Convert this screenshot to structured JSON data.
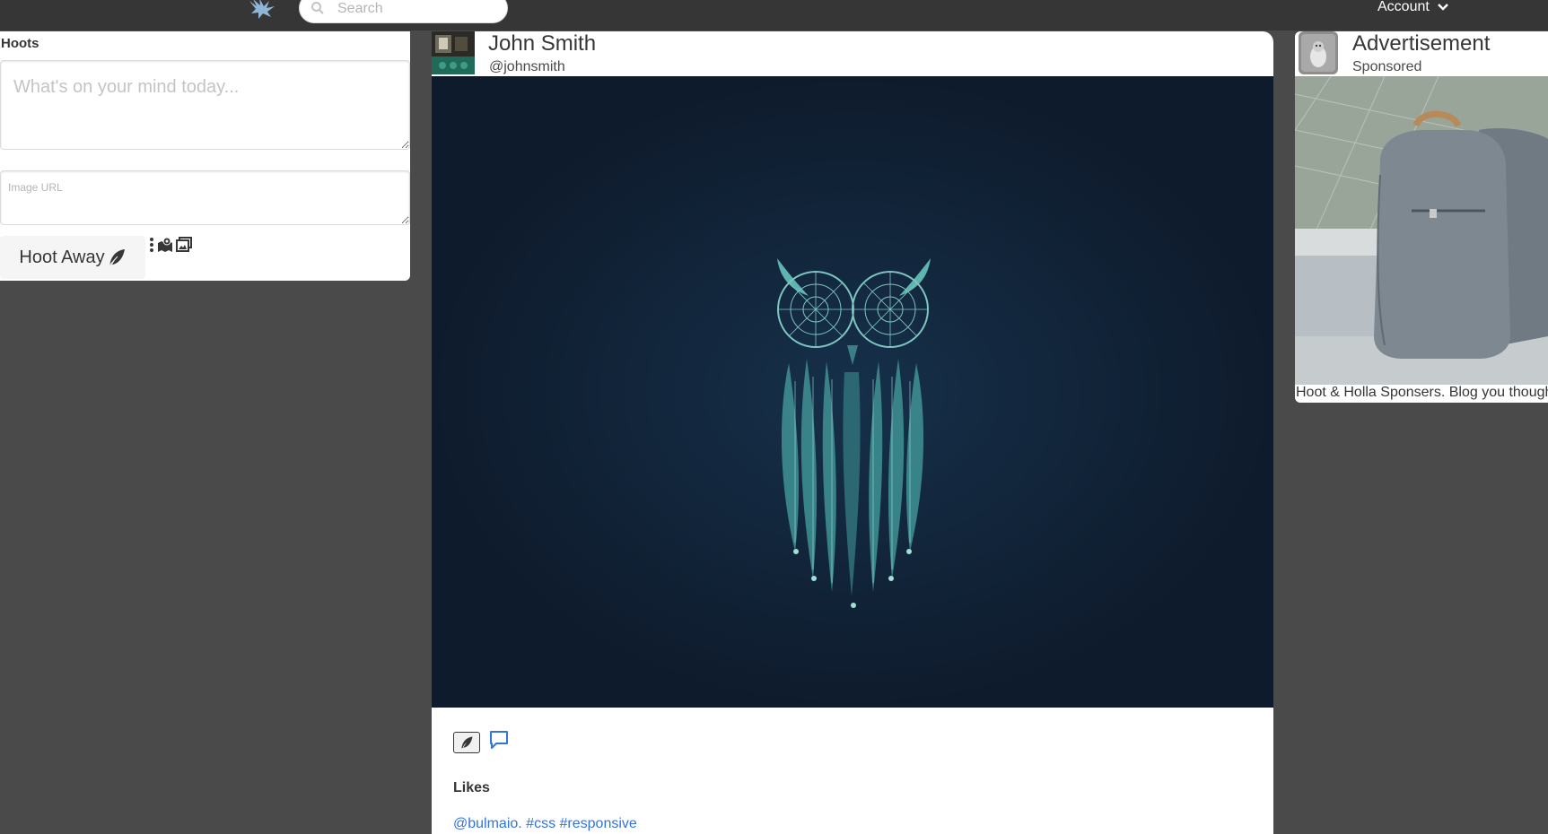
{
  "navbar": {
    "logo_icon": "hoot-bird-logo-icon",
    "search": {
      "placeholder": "Search",
      "value": "",
      "icon": "search-icon"
    },
    "account_label": "Account",
    "account_icon": "chevron-down-icon"
  },
  "compose": {
    "title": "Hoots",
    "text_placeholder": "What's on your mind today...",
    "text_value": "",
    "image_url_placeholder": "Image URL",
    "image_url_value": "",
    "submit_label": "Hoot Away",
    "submit_icon": "feather-icon",
    "tools": [
      "more-options-icon",
      "map-location-icon",
      "image-gallery-icon"
    ]
  },
  "post": {
    "author": "John Smith",
    "handle": "@johnsmith",
    "image_subject": "dreamcatcher-owl-illustration",
    "like_icon": "feather-icon",
    "comment_icon": "comment-icon",
    "likes_label": "Likes",
    "tags": [
      "@bulmaio.",
      "#css",
      "#responsive"
    ]
  },
  "ad": {
    "title": "Advertisement",
    "subtitle": "Sponsored",
    "image_subject": "grey-backpack-photo",
    "caption": "Hoot & Holla Sponsers. Blog you thoughts"
  },
  "colors": {
    "page_bg": "#4a4a4a",
    "navbar_bg": "#363636",
    "card_bg": "#ffffff",
    "link": "#3273dc",
    "post_image_bg": "#0e1b2c",
    "owl_accent": "#5fb3b0"
  }
}
